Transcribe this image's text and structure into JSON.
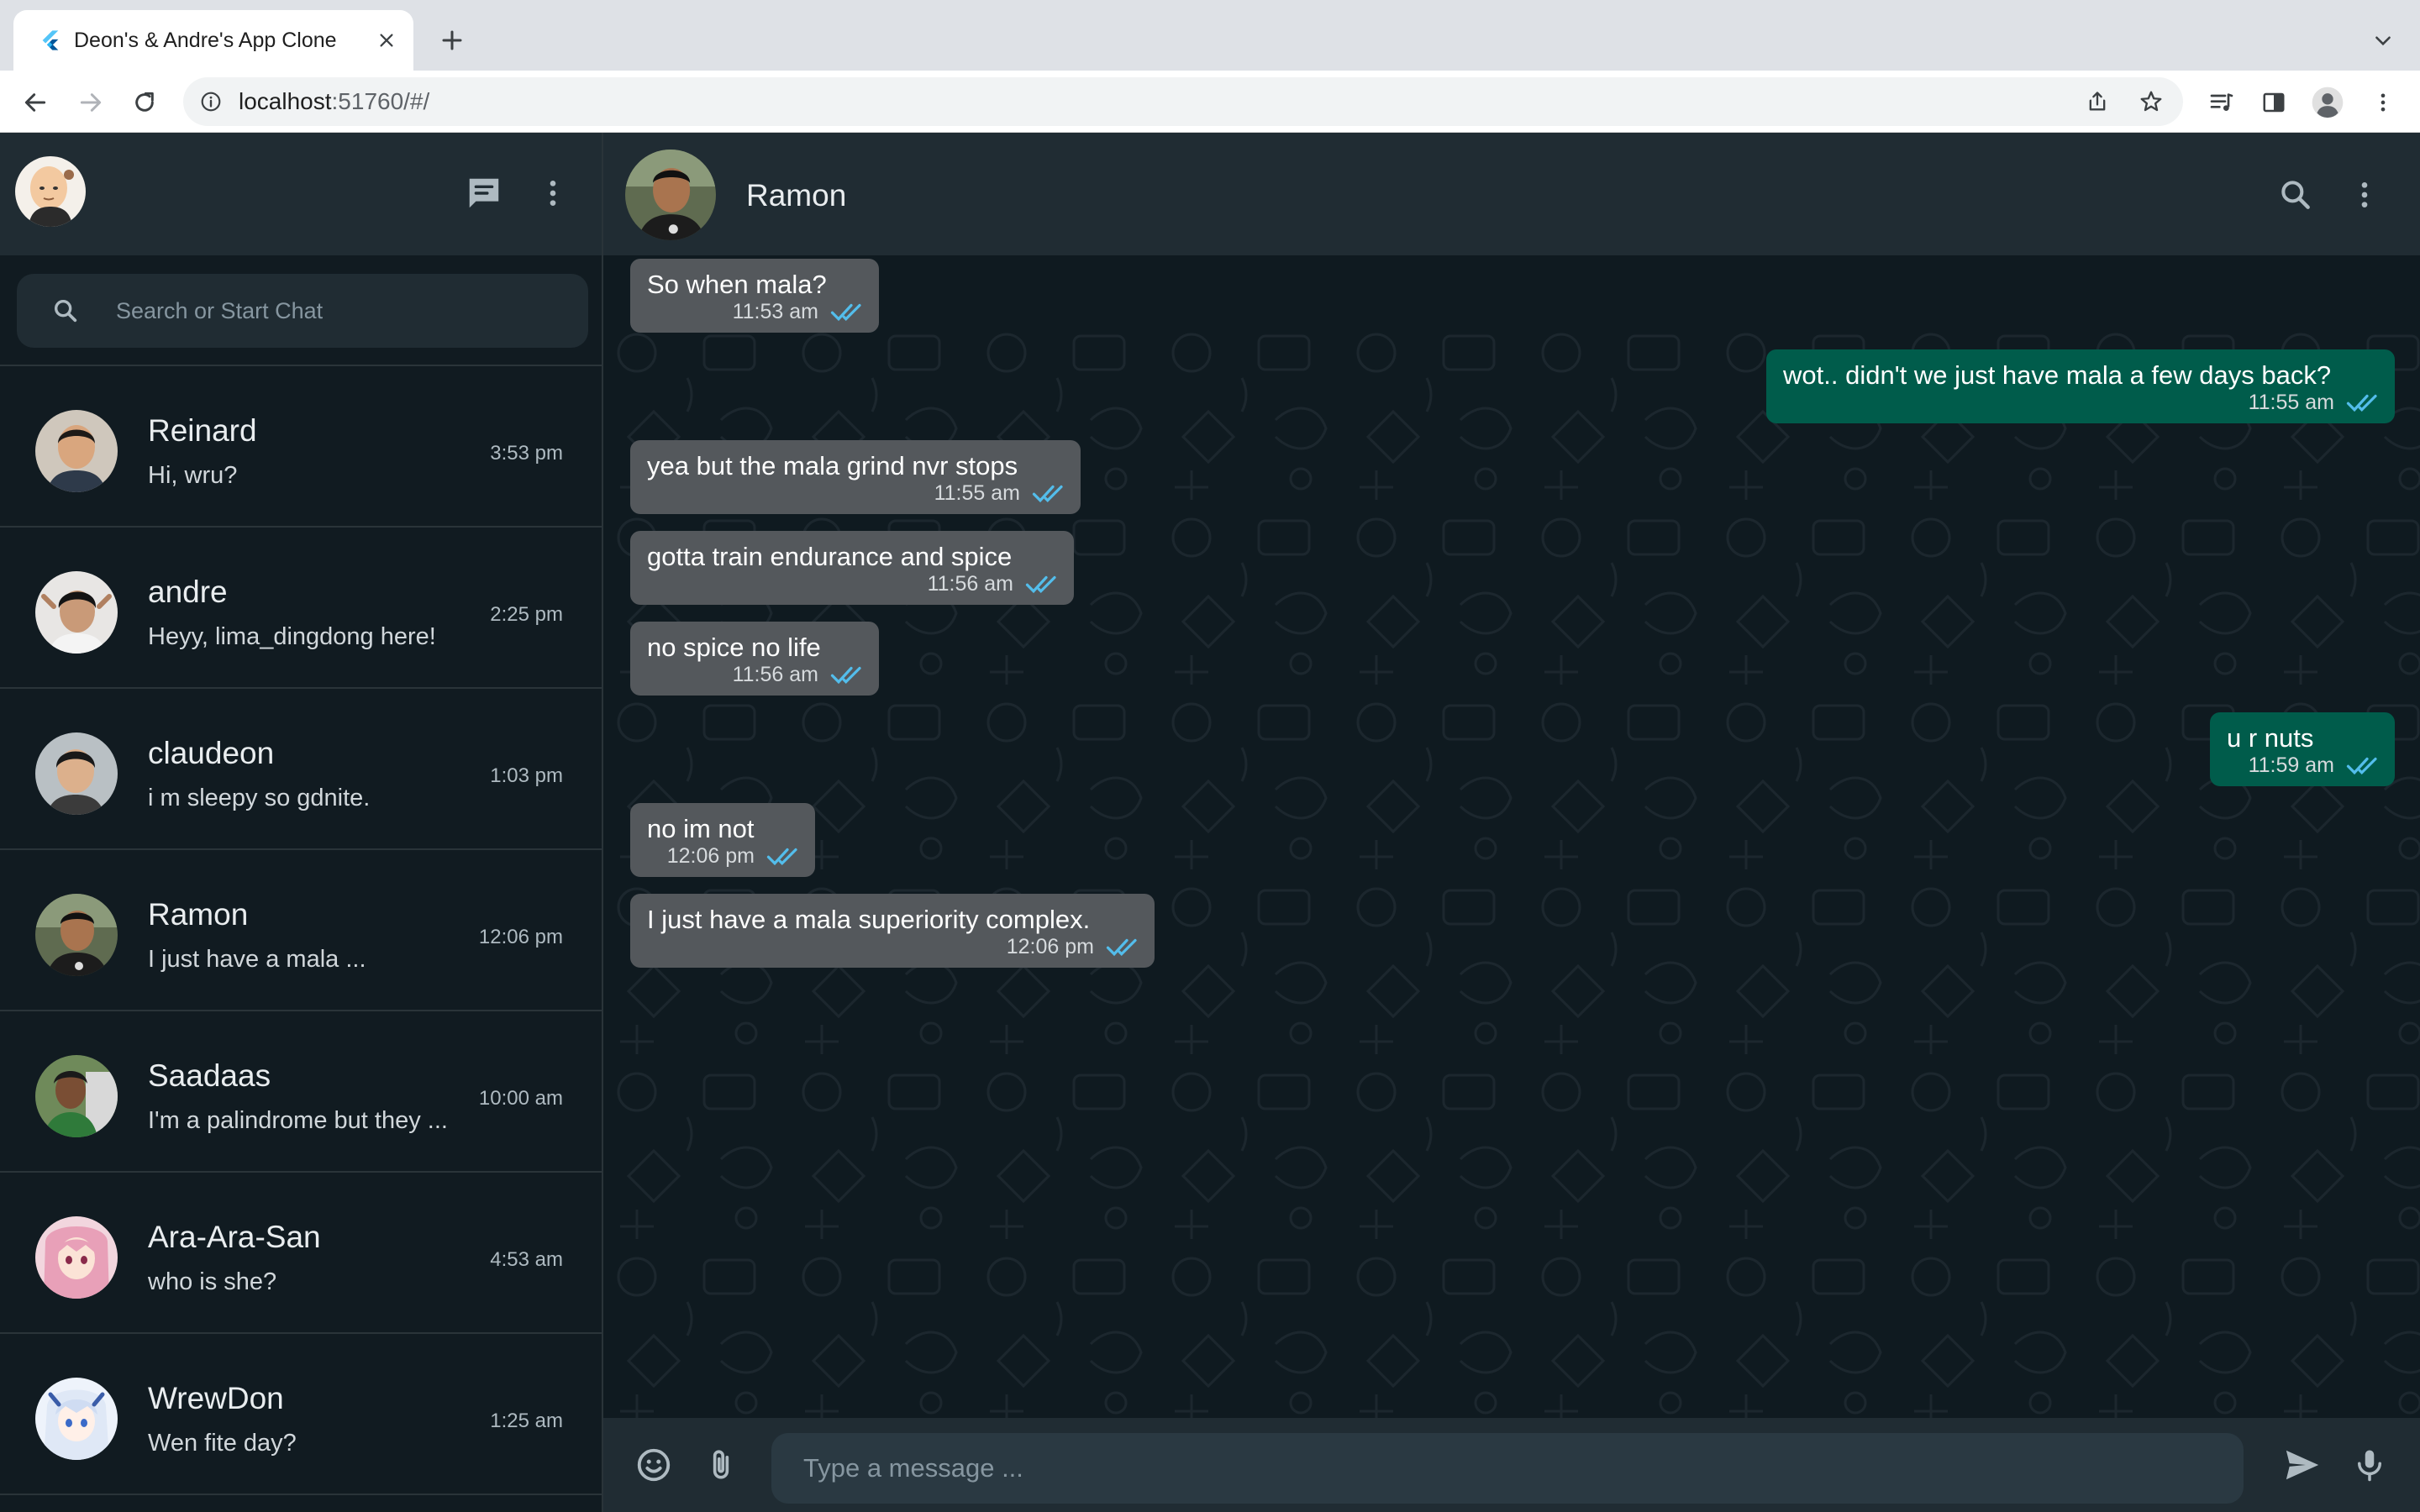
{
  "browser": {
    "tab_title": "Deon's & Andre's App Clone",
    "url_host": "localhost",
    "url_rest": ":51760/#/"
  },
  "sidebar": {
    "search_placeholder": "Search or Start Chat",
    "chats": [
      {
        "name": "Reinard",
        "last": "Hi, wru?",
        "time": "3:53 pm"
      },
      {
        "name": "andre",
        "last": "Heyy, lima_dingdong here!",
        "time": "2:25 pm"
      },
      {
        "name": "claudeon",
        "last": "i m sleepy so gdnite.",
        "time": "1:03 pm"
      },
      {
        "name": "Ramon",
        "last": "I just have a mala ...",
        "time": "12:06 pm"
      },
      {
        "name": "Saadaas",
        "last": "I'm a palindrome but they ...",
        "time": "10:00 am"
      },
      {
        "name": "Ara-Ara-San",
        "last": "who is she?",
        "time": "4:53 am"
      },
      {
        "name": "WrewDon",
        "last": "Wen fite day?",
        "time": "1:25 am"
      }
    ]
  },
  "conversation": {
    "contact_name": "Ramon",
    "messages": [
      {
        "dir": "in",
        "text": "So when mala?",
        "time": "11:53 am"
      },
      {
        "dir": "out",
        "text": "wot.. didn't we just have mala a few days back?",
        "time": "11:55 am"
      },
      {
        "dir": "in",
        "text": "yea but the mala grind nvr stops",
        "time": "11:55 am"
      },
      {
        "dir": "in",
        "text": "gotta train endurance and spice",
        "time": "11:56 am"
      },
      {
        "dir": "in",
        "text": "no spice no life",
        "time": "11:56 am"
      },
      {
        "dir": "out",
        "text": "u r nuts",
        "time": "11:59 am"
      },
      {
        "dir": "in",
        "text": "no im not",
        "time": "12:06 pm"
      },
      {
        "dir": "in",
        "text": "I just have a mala superiority complex.",
        "time": "12:06 pm"
      }
    ],
    "input_placeholder": "Type a message ..."
  },
  "colors": {
    "incoming_bubble": "#54585c",
    "outgoing_bubble": "#005c4b",
    "read_check": "#53bdeb",
    "panel": "#202c33",
    "background": "#111b21"
  }
}
